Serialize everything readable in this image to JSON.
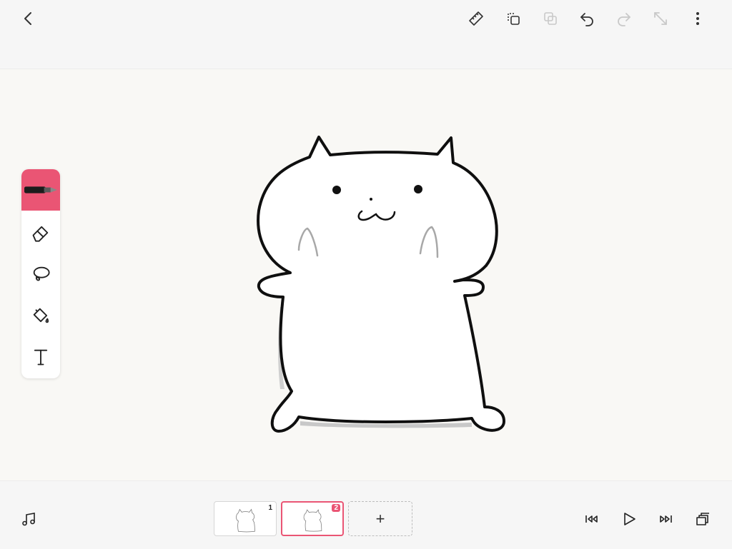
{
  "header": {
    "back_icon": "chevron-left-icon",
    "actions": [
      {
        "name": "ruler",
        "icon": "ruler-icon",
        "enabled": true
      },
      {
        "name": "copy-frame",
        "icon": "copy-icon",
        "enabled": true
      },
      {
        "name": "paste-frame",
        "icon": "paste-icon",
        "enabled": false
      },
      {
        "name": "undo",
        "icon": "undo-icon",
        "enabled": true
      },
      {
        "name": "redo",
        "icon": "redo-icon",
        "enabled": false
      },
      {
        "name": "fullscreen",
        "icon": "expand-icon",
        "enabled": false
      },
      {
        "name": "more",
        "icon": "more-vertical-icon",
        "enabled": true
      }
    ]
  },
  "tools": [
    {
      "name": "pen",
      "icon": "pen-icon",
      "active": true
    },
    {
      "name": "eraser",
      "icon": "eraser-icon",
      "active": false
    },
    {
      "name": "lasso",
      "icon": "lasso-icon",
      "active": false
    },
    {
      "name": "fill",
      "icon": "paint-bucket-icon",
      "active": false
    },
    {
      "name": "text",
      "icon": "text-icon",
      "active": false
    }
  ],
  "timeline": {
    "frames": [
      {
        "number": "1",
        "selected": false
      },
      {
        "number": "2",
        "selected": true
      }
    ],
    "add_label": "+",
    "controls": [
      "music-icon",
      "skip-back-icon",
      "play-icon",
      "skip-forward-icon",
      "layers-icon"
    ]
  },
  "colors": {
    "accent": "#ea5574",
    "toolbar_bg": "#f6f6f6",
    "canvas_bg": "#f9f8f5",
    "ink": "#111111"
  }
}
